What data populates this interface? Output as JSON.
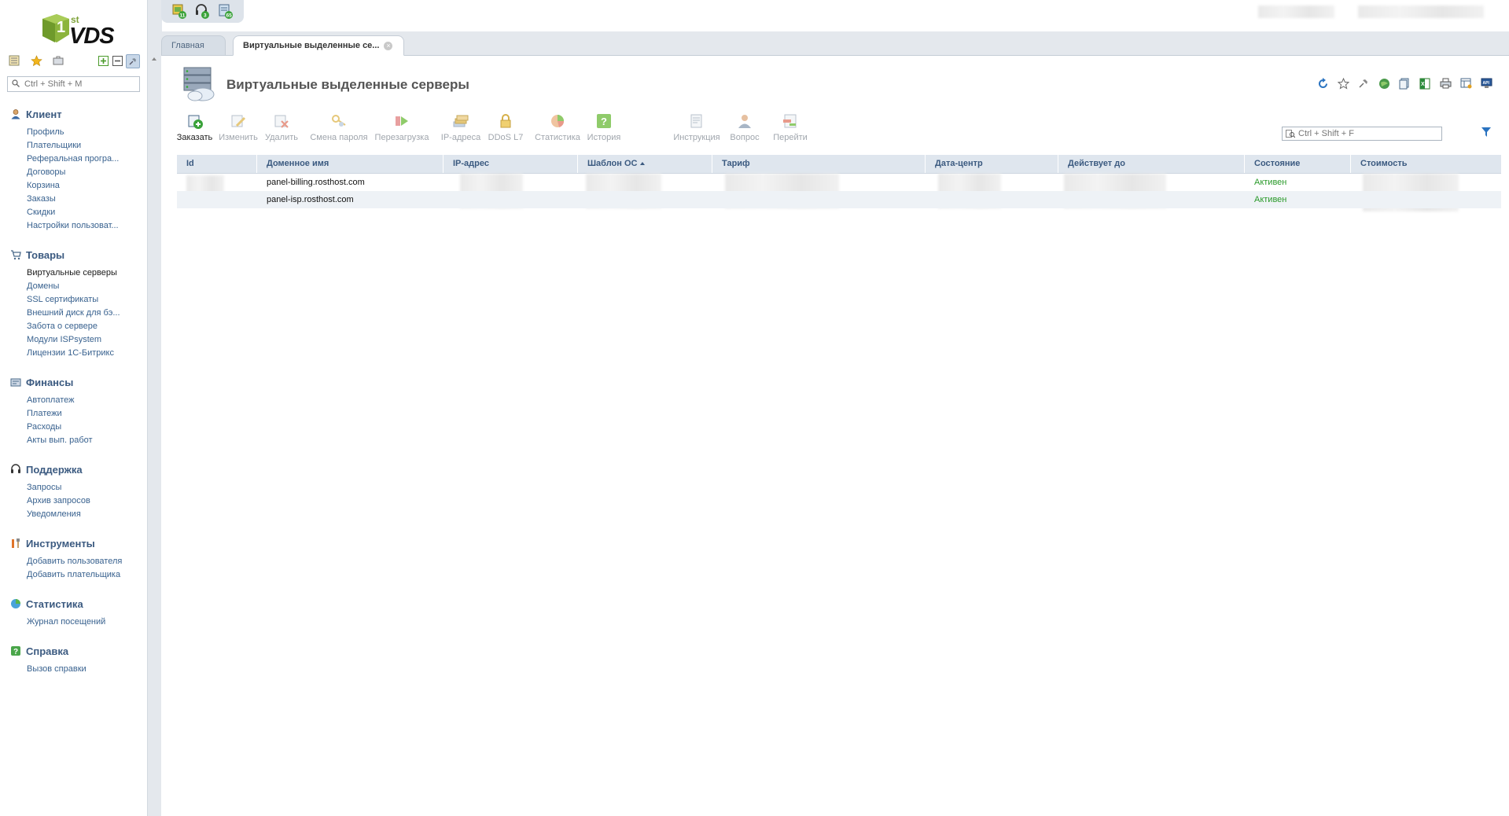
{
  "logo": {
    "brand": "VDS",
    "superscript": "st"
  },
  "sidebar": {
    "search_placeholder": "Ctrl + Shift + M",
    "groups": [
      {
        "title": "Клиент",
        "icon": "user-icon",
        "items": [
          "Профиль",
          "Плательщики",
          "Реферальная програ...",
          "Договоры",
          "Корзина",
          "Заказы",
          "Скидки",
          "Настройки пользоват..."
        ]
      },
      {
        "title": "Товары",
        "icon": "cart-icon",
        "items": [
          "Виртуальные серверы",
          "Домены",
          "SSL сертификаты",
          "Внешний диск для бэ...",
          "Забота о сервере",
          "Модули ISPsystem",
          "Лицензии 1С-Битрикс"
        ]
      },
      {
        "title": "Финансы",
        "icon": "finance-icon",
        "items": [
          "Автоплатеж",
          "Платежи",
          "Расходы",
          "Акты вып. работ"
        ]
      },
      {
        "title": "Поддержка",
        "icon": "headset-icon",
        "items": [
          "Запросы",
          "Архив запросов",
          "Уведомления"
        ]
      },
      {
        "title": "Инструменты",
        "icon": "tools-icon",
        "items": [
          "Добавить пользователя",
          "Добавить плательщика"
        ]
      },
      {
        "title": "Статистика",
        "icon": "stats-icon",
        "items": [
          "Журнал посещений"
        ]
      },
      {
        "title": "Справка",
        "icon": "help-icon",
        "items": [
          "Вызов справки"
        ]
      }
    ]
  },
  "top_icons": [
    {
      "icon": "orders-icon",
      "badge": "11"
    },
    {
      "icon": "support-icon",
      "badge": "3"
    },
    {
      "icon": "invoices-icon",
      "badge": "65"
    }
  ],
  "tabs": [
    {
      "label": "Главная"
    },
    {
      "label": "Виртуальные выделенные се..."
    }
  ],
  "page": {
    "title": "Виртуальные выделенные серверы"
  },
  "toolbar": [
    {
      "label": "Заказать",
      "icon": "order-add-icon",
      "enabled": true
    },
    {
      "label": "Изменить",
      "icon": "edit-icon",
      "enabled": false
    },
    {
      "label": "Удалить",
      "icon": "delete-icon",
      "enabled": false
    },
    {
      "label": "Смена пароля",
      "icon": "key-icon",
      "enabled": false
    },
    {
      "label": "Перезагрузка",
      "icon": "reboot-icon",
      "enabled": false
    },
    {
      "label": "IP-адреса",
      "icon": "ip-icon",
      "enabled": false
    },
    {
      "label": "DDoS L7",
      "icon": "lock-icon",
      "enabled": false
    },
    {
      "label": "Статистика",
      "icon": "pie-icon",
      "enabled": false
    },
    {
      "label": "История",
      "icon": "history-icon",
      "enabled": false
    },
    {
      "label": "Инструкция",
      "icon": "instruction-icon",
      "enabled": false
    },
    {
      "label": "Вопрос",
      "icon": "question-user-icon",
      "enabled": false
    },
    {
      "label": "Перейти",
      "icon": "goto-icon",
      "enabled": false
    }
  ],
  "filter": {
    "placeholder": "Ctrl + Shift + F"
  },
  "table": {
    "columns": [
      "Id",
      "Доменное имя",
      "IP-адрес",
      "Шаблон ОС",
      "Тариф",
      "Дата-центр",
      "Действует до",
      "Состояние",
      "Стоимость"
    ],
    "rows": [
      {
        "domain": "panel-billing.rosthost.com",
        "status": "Активен"
      },
      {
        "domain": "panel-isp.rosthost.com",
        "status": "Активен"
      }
    ]
  },
  "colors": {
    "accent": "#3b5a80",
    "status_active": "#2a9a2a",
    "header_bg": "#dfe6ee"
  }
}
